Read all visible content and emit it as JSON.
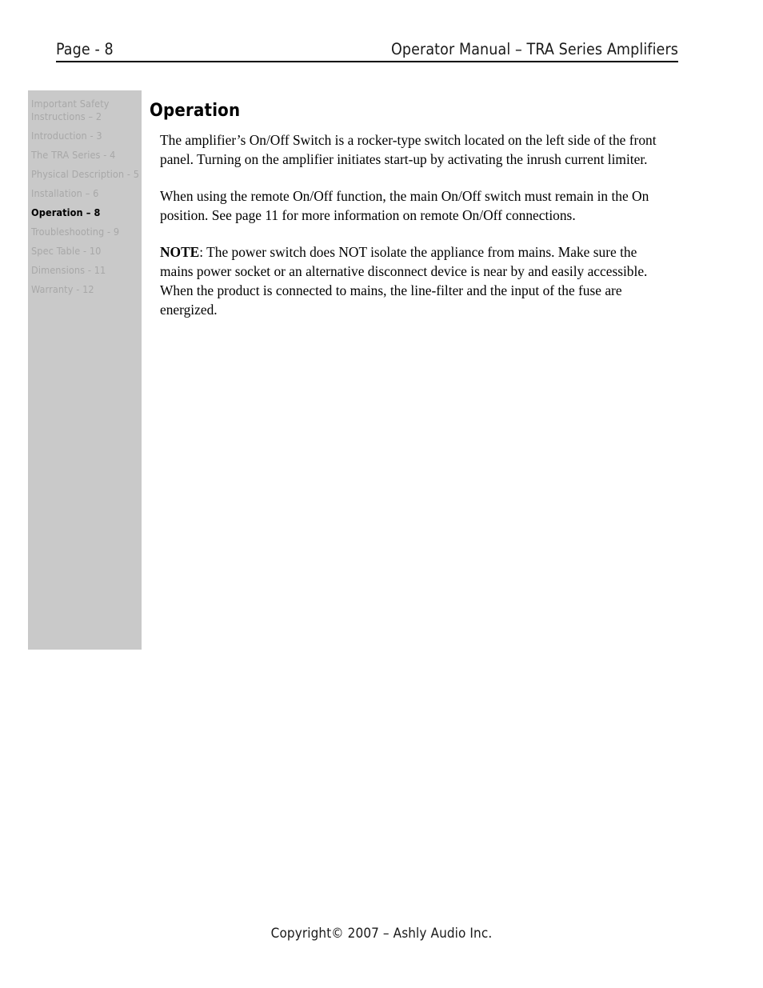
{
  "header": {
    "page_label": "Page - 8",
    "manual_title": "Operator Manual – TRA Series Amplifiers"
  },
  "sidebar": {
    "items": [
      {
        "label": "Important Safety Instructions – 2",
        "active": false
      },
      {
        "label": "Introduction - 3",
        "active": false
      },
      {
        "label": "The TRA Series - 4",
        "active": false
      },
      {
        "label": "Physical Description - 5",
        "active": false
      },
      {
        "label": "Installation – 6",
        "active": false
      },
      {
        "label": "Operation – 8",
        "active": true
      },
      {
        "label": "Troubleshooting - 9",
        "active": false
      },
      {
        "label": "Spec Table - 10",
        "active": false
      },
      {
        "label": "Dimensions - 11",
        "active": false
      },
      {
        "label": "Warranty - 12",
        "active": false
      }
    ]
  },
  "main": {
    "section_title": "Operation",
    "paragraphs": [
      "The amplifier’s On/Off Switch is a rocker-type switch located on the left side of the front panel.  Turning on the amplifier initiates start-up by activating the inrush current limiter.",
      "When using the remote On/Off function, the main On/Off switch must remain in the On position.  See page 11 for more information on remote On/Off connections."
    ],
    "note": {
      "label": "NOTE",
      "text": ": The power switch does NOT isolate the appliance from mains. Make sure the mains power socket or an alternative disconnect device is near by and easily accessible. When the product is connected to mains, the line-filter and the input of the fuse are energized."
    }
  },
  "footer": {
    "copyright": "Copyright© 2007 – Ashly Audio Inc."
  },
  "colors": {
    "sidebar_background": "#c9c9c9",
    "sidebar_inactive_text": "#a8a8a8",
    "sidebar_active_text": "#000000",
    "body_text": "#000000",
    "page_background": "#ffffff"
  }
}
